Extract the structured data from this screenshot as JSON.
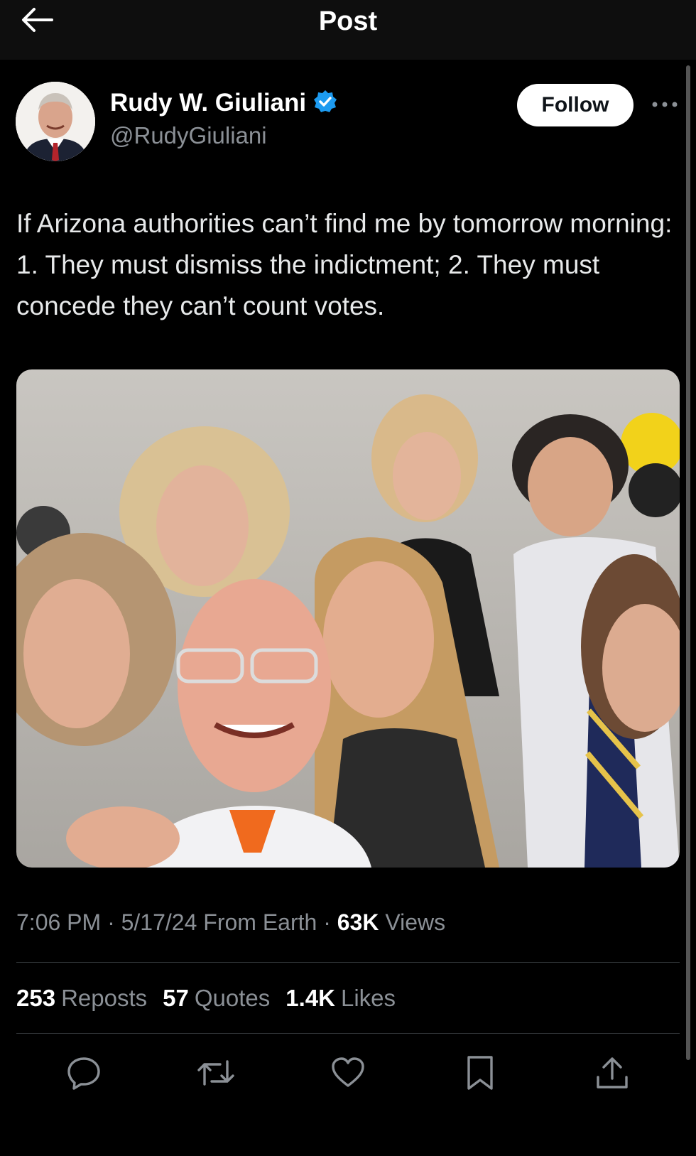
{
  "header": {
    "title": "Post",
    "back_icon": "arrow-left-icon"
  },
  "author": {
    "name": "Rudy W. Giuliani",
    "handle": "@RudyGiuliani",
    "verified_icon": "verified-badge-icon",
    "verified_color": "#1d9bf0"
  },
  "follow_label": "Follow",
  "more_icon": "more-horizontal-icon",
  "tweet": {
    "text": "If Arizona authorities can’t find me by tomorrow morning: 1. They must dismiss the indictment; 2. They must concede they can’t count votes."
  },
  "meta": {
    "time": "7:06 PM",
    "sep1": " · ",
    "date": "5/17/24",
    "source": " From Earth",
    "sep2": " · ",
    "views_count": "63K",
    "views_label": " Views"
  },
  "stats": [
    {
      "count": "253",
      "label": "Reposts"
    },
    {
      "count": "57",
      "label": "Quotes"
    },
    {
      "count": "1.4K",
      "label": "Likes"
    }
  ],
  "actions": [
    {
      "icon": "reply-icon"
    },
    {
      "icon": "repost-icon"
    },
    {
      "icon": "like-icon"
    },
    {
      "icon": "bookmark-icon"
    },
    {
      "icon": "share-icon"
    }
  ],
  "colors": {
    "background": "#000000",
    "text": "#e7e9ea",
    "secondary_text": "#8b9096",
    "accent": "#1d9bf0"
  }
}
